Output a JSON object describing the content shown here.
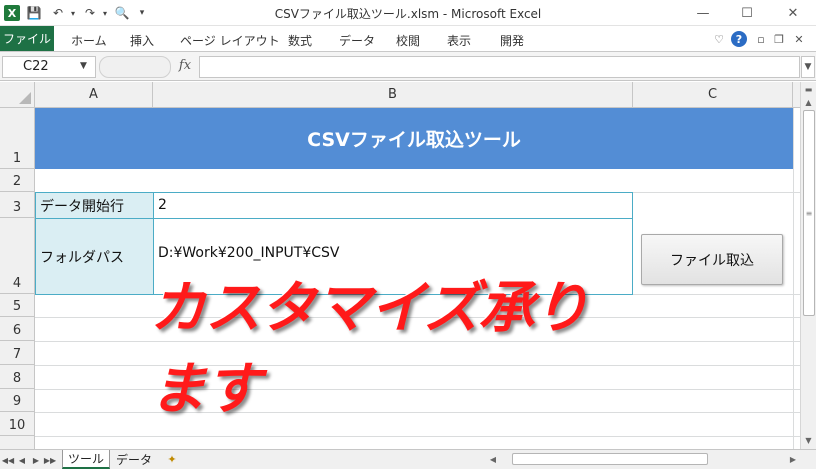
{
  "titlebar": {
    "title": "CSVファイル取込ツール.xlsm  -  Microsoft Excel",
    "app_icon": "X"
  },
  "ribbon": {
    "tabs": [
      {
        "label": "ファイル"
      },
      {
        "label": "ホーム"
      },
      {
        "label": "挿入"
      },
      {
        "label": "ページ レイアウト"
      },
      {
        "label": "数式"
      },
      {
        "label": "データ"
      },
      {
        "label": "校閲"
      },
      {
        "label": "表示"
      },
      {
        "label": "開発"
      }
    ]
  },
  "formulabar": {
    "namebox": "C22",
    "fx": "fx",
    "value": ""
  },
  "grid": {
    "columns": [
      "A",
      "B",
      "C"
    ],
    "rows": [
      "1",
      "2",
      "3",
      "4",
      "5",
      "6",
      "7",
      "8",
      "9",
      "10"
    ]
  },
  "sheet": {
    "title": "CSVファイル取込ツール",
    "start_row_label": "データ開始行",
    "start_row_value": "2",
    "folder_label": "フォルダパス",
    "folder_value": "D:¥Work¥200_INPUT¥CSV",
    "import_button": "ファイル取込",
    "promo": "カスタマイズ承ります"
  },
  "sheet_tabs": [
    {
      "label": "ツール"
    },
    {
      "label": "データ"
    }
  ],
  "colors": {
    "banner": "#538dd5",
    "label_fill": "#daeef3",
    "border": "#4bacc6",
    "promo": "#ff1a1a",
    "file_tab": "#1e7145"
  }
}
